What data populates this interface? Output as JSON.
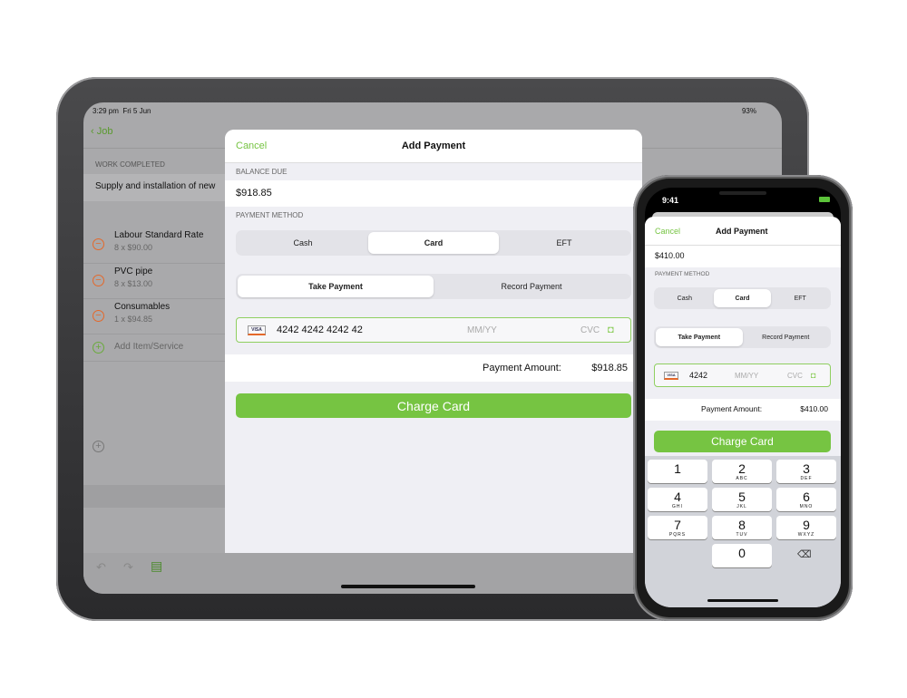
{
  "ipad": {
    "status_time": "3:29 pm",
    "status_date": "Fri 5 Jun",
    "battery": "93%",
    "back_label": "Job",
    "section_work": "WORK COMPLETED",
    "work_text": "Supply and installation of new",
    "items": [
      {
        "name": "Labour Standard Rate",
        "detail": "8 x $90.00"
      },
      {
        "name": "PVC pipe",
        "detail": "8 x $13.00"
      },
      {
        "name": "Consumables",
        "detail": "1 x $94.85"
      }
    ],
    "add_item": "Add Item/Service",
    "modal": {
      "cancel": "Cancel",
      "title": "Add Payment",
      "balance_label": "BALANCE DUE",
      "balance": "$918.85",
      "method_label": "PAYMENT METHOD",
      "methods": [
        "Cash",
        "Card",
        "EFT"
      ],
      "selected_method": "Card",
      "modes": [
        "Take Payment",
        "Record Payment"
      ],
      "selected_mode": "Take Payment",
      "card_number": "4242 4242 4242 42",
      "expiry_placeholder": "MM/YY",
      "cvc_placeholder": "CVC",
      "amount_label": "Payment Amount:",
      "amount": "$918.85",
      "charge": "Charge Card"
    }
  },
  "iphone": {
    "status_time": "9:41",
    "cancel": "Cancel",
    "title": "Add Payment",
    "balance": "$410.00",
    "method_label": "PAYMENT METHOD",
    "methods": [
      "Cash",
      "Card",
      "EFT"
    ],
    "selected_method": "Card",
    "modes": [
      "Take Payment",
      "Record Payment"
    ],
    "selected_mode": "Take Payment",
    "card_number": "4242",
    "expiry_placeholder": "MM/YY",
    "cvc_placeholder": "CVC",
    "amount_label": "Payment Amount:",
    "amount": "$410.00",
    "charge": "Charge Card",
    "keys": [
      {
        "n": "1",
        "l": ""
      },
      {
        "n": "2",
        "l": "ABC"
      },
      {
        "n": "3",
        "l": "DEF"
      },
      {
        "n": "4",
        "l": "GHI"
      },
      {
        "n": "5",
        "l": "JKL"
      },
      {
        "n": "6",
        "l": "MNO"
      },
      {
        "n": "7",
        "l": "PQRS"
      },
      {
        "n": "8",
        "l": "TUV"
      },
      {
        "n": "9",
        "l": "WXYZ"
      },
      {
        "n": "0",
        "l": ""
      }
    ]
  },
  "colors": {
    "accent": "#76c442",
    "remove": "#e4682a"
  }
}
